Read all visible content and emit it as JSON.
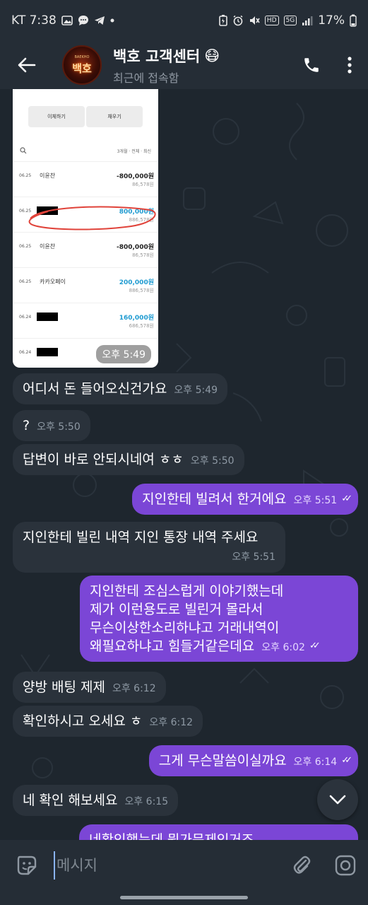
{
  "status_bar": {
    "carrier_time": "KT 7:38",
    "battery": "17%",
    "indicators": [
      "gallery-icon",
      "chat-icon",
      "telegram-icon",
      "dot-icon",
      "battery-saver-icon",
      "alarm-icon",
      "mute-icon",
      "hd-icon",
      "5g-icon",
      "signal-icon"
    ]
  },
  "header": {
    "title": "백호 고객센터",
    "title_emoji": "😷",
    "subtitle": "최근에 접속함",
    "avatar_text": "백호",
    "avatar_subtext": "BAEKHO"
  },
  "image_message": {
    "buttons": [
      "이체하기",
      "채우기"
    ],
    "filter": "3개월 · 전체 · 최신",
    "rows": [
      {
        "date": "06.25",
        "name": "이윤찬",
        "amount": "-800,000원",
        "balance": "86,578원",
        "color": "dark",
        "redacted": false
      },
      {
        "date": "06.25",
        "name": "",
        "amount": "800,000원",
        "balance": "886,578원",
        "color": "blue",
        "redacted": true
      },
      {
        "date": "06.25",
        "name": "이윤찬",
        "amount": "-800,000원",
        "balance": "86,578원",
        "color": "dark",
        "redacted": false
      },
      {
        "date": "06.25",
        "name": "카카오페이",
        "amount": "200,000원",
        "balance": "886,578원",
        "color": "blue",
        "redacted": false
      },
      {
        "date": "06.24",
        "name": "",
        "amount": "160,000원",
        "balance": "686,578원",
        "color": "blue",
        "redacted": true
      },
      {
        "date": "06.24",
        "name": "",
        "amount": "",
        "balance": "",
        "color": "blue",
        "redacted": true
      }
    ],
    "time": "오후 5:49"
  },
  "messages": [
    {
      "dir": "in",
      "text": "어디서 돈 들어오신건가요",
      "time": "오후 5:49"
    },
    {
      "dir": "in",
      "text": "?",
      "time": "오후 5:50"
    },
    {
      "dir": "in",
      "text": "답변이 바로 안되시네여 ㅎㅎ",
      "time": "오후 5:50"
    },
    {
      "dir": "out",
      "text": "지인한테 빌려서 한거에요",
      "time": "오후 5:51"
    },
    {
      "dir": "in",
      "text": "지인한테 빌린 내역 지인 통장 내역 주세요",
      "time": "오후 5:51"
    },
    {
      "dir": "out",
      "lines": [
        "지인한테 조심스럽게 이야기했는데",
        "제가 이런용도로 빌린거 몰라서",
        "무슨이상한소리하냐고 거래내역이",
        "왜필요하냐고  힘들거같은데요"
      ],
      "time": "오후 6:02"
    },
    {
      "dir": "in",
      "text": "양방 배팅 제제",
      "time": "오후 6:12"
    },
    {
      "dir": "in",
      "text": "확인하시고 오세요 ㅎ",
      "time": "오후 6:12"
    },
    {
      "dir": "out",
      "text": "그게 무슨말씀이실까요",
      "time": "오후 6:14"
    },
    {
      "dir": "in",
      "text": "네 확인 해보세요",
      "time": "오후 6:15"
    },
    {
      "dir": "out",
      "text": "네확인했는데 뭔가문제인거죠",
      "time": ""
    }
  ],
  "composer": {
    "placeholder": "메시지"
  },
  "colors": {
    "outgoing_bubble": "#7b46d6",
    "incoming_bubble": "#2a323b",
    "background": "#1e262e",
    "header": "#252d36"
  }
}
